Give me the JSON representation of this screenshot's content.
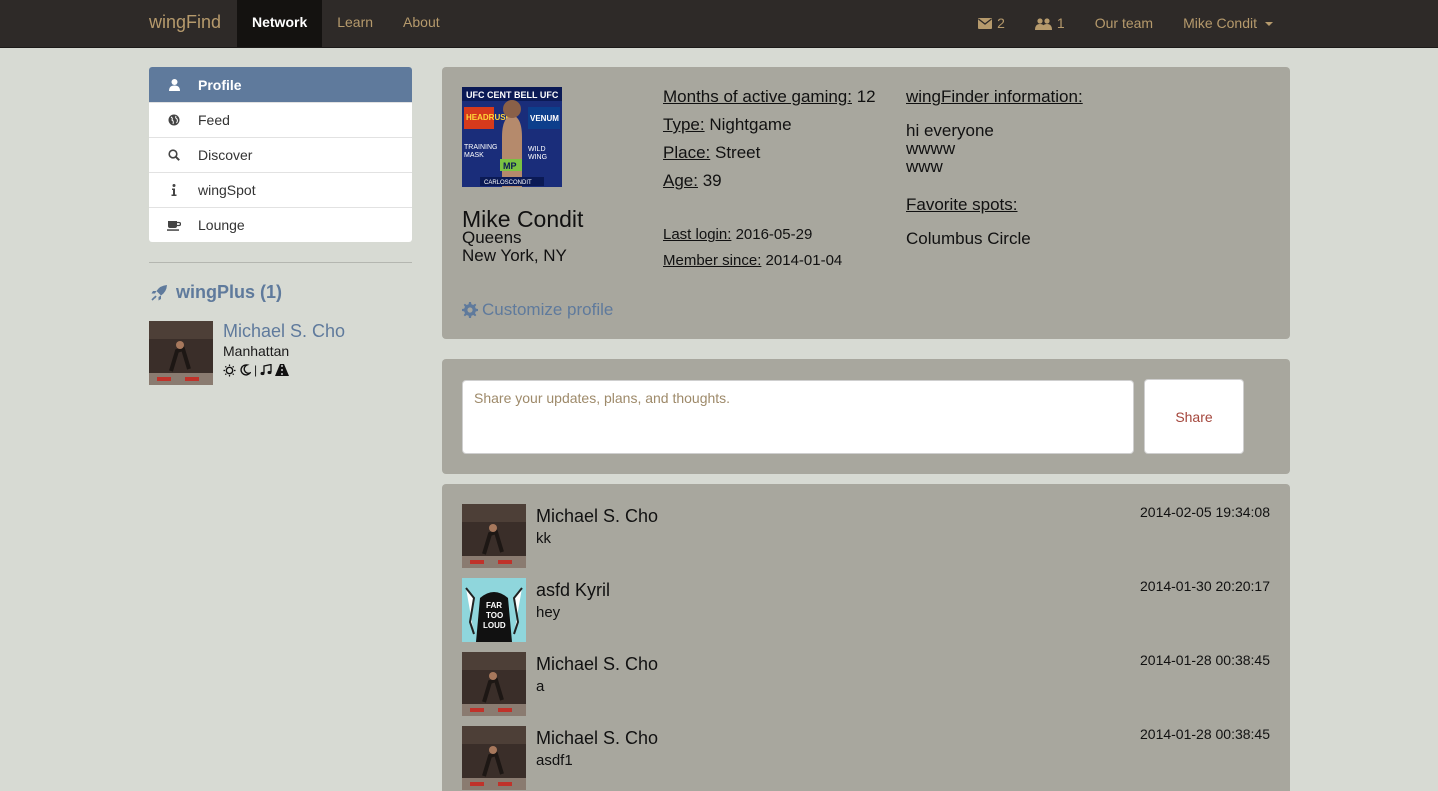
{
  "navbar": {
    "brand": "wingFind",
    "left_links": [
      {
        "label": "Network",
        "active": true
      },
      {
        "label": "Learn",
        "active": false
      },
      {
        "label": "About",
        "active": false
      }
    ],
    "messages_count": "2",
    "friends_count": "1",
    "our_team": "Our team",
    "user_menu": "Mike Condit"
  },
  "sidebar": {
    "items": [
      {
        "label": "Profile",
        "icon": "user-icon",
        "active": true
      },
      {
        "label": "Feed",
        "icon": "globe-icon",
        "active": false
      },
      {
        "label": "Discover",
        "icon": "search-icon",
        "active": false
      },
      {
        "label": "wingSpot",
        "icon": "info-icon",
        "active": false
      },
      {
        "label": "Lounge",
        "icon": "coffee-icon",
        "active": false
      }
    ],
    "wingplus": {
      "heading": "wingPlus (1)",
      "user": {
        "name": "Michael S. Cho",
        "location": "Manhattan",
        "separator": "|"
      }
    }
  },
  "profile": {
    "name": "Mike Condit",
    "city": "Queens",
    "state": "New York, NY",
    "customize_label": "Customize profile",
    "months_label": "Months of active gaming:",
    "months_value": "12",
    "type_label": "Type:",
    "type_value": "Nightgame",
    "place_label": "Place:",
    "place_value": "Street",
    "age_label": "Age:",
    "age_value": "39",
    "last_login_label": "Last login:",
    "last_login_value": "2016-05-29",
    "member_since_label": "Member since:",
    "member_since_value": "2014-01-04",
    "info_heading": "wingFinder information:",
    "info_lines": [
      "hi everyone",
      "wwww",
      "www"
    ],
    "spots_heading": "Favorite spots:",
    "spots_value": "Columbus Circle"
  },
  "share": {
    "placeholder": "Share your updates, plans, and thoughts.",
    "button_label": "Share"
  },
  "feed": [
    {
      "name": "Michael S. Cho",
      "text": "kk",
      "time": "2014-02-05 19:34:08",
      "avatar": "arena"
    },
    {
      "name": "asfd Kyril",
      "text": "hey",
      "time": "2014-01-30 20:20:17",
      "avatar": "loud"
    },
    {
      "name": "Michael S. Cho",
      "text": "a",
      "time": "2014-01-28 00:38:45",
      "avatar": "arena"
    },
    {
      "name": "Michael S. Cho",
      "text": "asdf1",
      "time": "2014-01-28 00:38:45",
      "avatar": "arena"
    }
  ],
  "colors": {
    "navbar_bg": "#2e2a28",
    "accent_gold": "#b69a6c",
    "accent_blue": "#5f7a9c",
    "panel_bg": "#a8a79e",
    "page_bg": "#d7dad3",
    "share_text": "#a4463c"
  }
}
